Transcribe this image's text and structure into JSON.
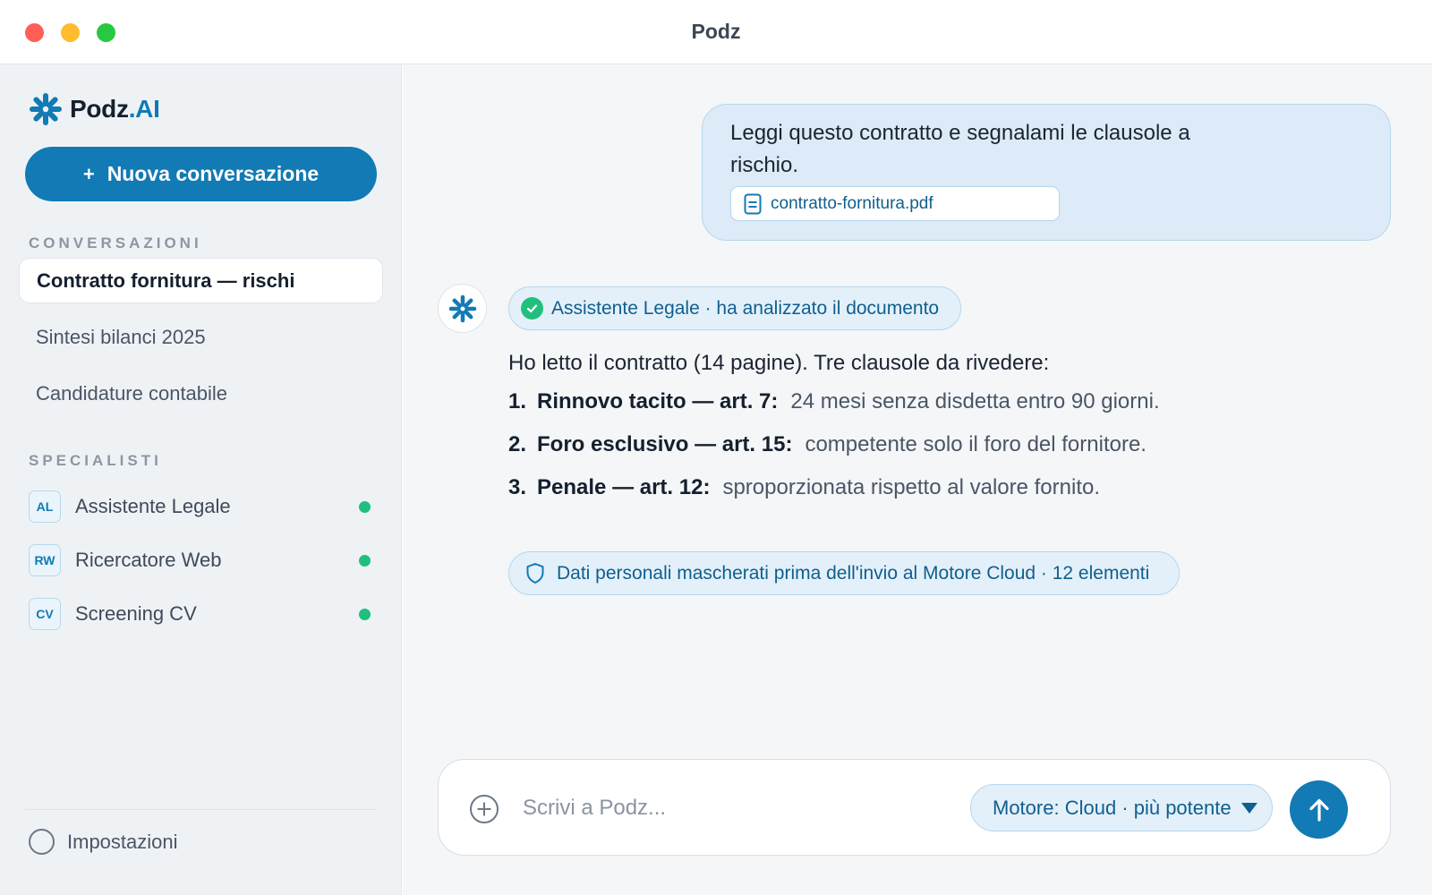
{
  "window": {
    "title": "Podz"
  },
  "sidebar": {
    "logo": {
      "name": "Podz",
      "accent": ".AI"
    },
    "new_chat_label": "Nuova conversazione",
    "conversations_heading": "CONVERSAZIONI",
    "conversations": [
      {
        "label": "Contratto fornitura — rischi",
        "active": true
      },
      {
        "label": "Sintesi bilanci 2025",
        "active": false
      },
      {
        "label": "Candidature contabile",
        "active": false
      }
    ],
    "specialists_heading": "SPECIALISTI",
    "specialists": [
      {
        "badge": "AL",
        "label": "Assistente Legale",
        "status": "online"
      },
      {
        "badge": "RW",
        "label": "Ricercatore Web",
        "status": "online"
      },
      {
        "badge": "CV",
        "label": "Screening CV",
        "status": "online"
      }
    ],
    "settings_label": "Impostazioni"
  },
  "chat": {
    "user_message": {
      "text": "Leggi questo contratto e segnalami le clausole a rischio.",
      "attachment": "contratto-fornitura.pdf"
    },
    "assistant": {
      "status": "Assistente Legale · ha analizzato il documento",
      "intro": "Ho letto il contratto (14 pagine). Tre clausole da rivedere:",
      "clauses": [
        {
          "num": "1.",
          "title": "Rinnovo tacito — art. 7:",
          "desc": "24 mesi senza disdetta entro 90 giorni."
        },
        {
          "num": "2.",
          "title": "Foro esclusivo — art. 15:",
          "desc": "competente solo il foro del fornitore."
        },
        {
          "num": "3.",
          "title": "Penale — art. 12:",
          "desc": "sproporzionata rispetto al valore fornito."
        }
      ],
      "privacy_note": "Dati personali mascherati prima dell'invio al Motore Cloud · 12 elementi"
    }
  },
  "composer": {
    "placeholder": "Scrivi a Podz...",
    "engine_label": "Motore: Cloud · più potente"
  },
  "colors": {
    "accent": "#127ab4",
    "online": "#1fbf7d",
    "sidebar_bg": "#eff2f5",
    "main_bg": "#f4f6f8",
    "bubble_bg": "#dcebf7"
  },
  "icons": {
    "logo": "asterisk-logo-icon",
    "attachment": "document-icon",
    "status": "check-circle-icon",
    "privacy": "shield-icon",
    "composer_attach": "plus-circle-icon",
    "send": "arrow-up-icon",
    "settings": "circle-icon"
  }
}
